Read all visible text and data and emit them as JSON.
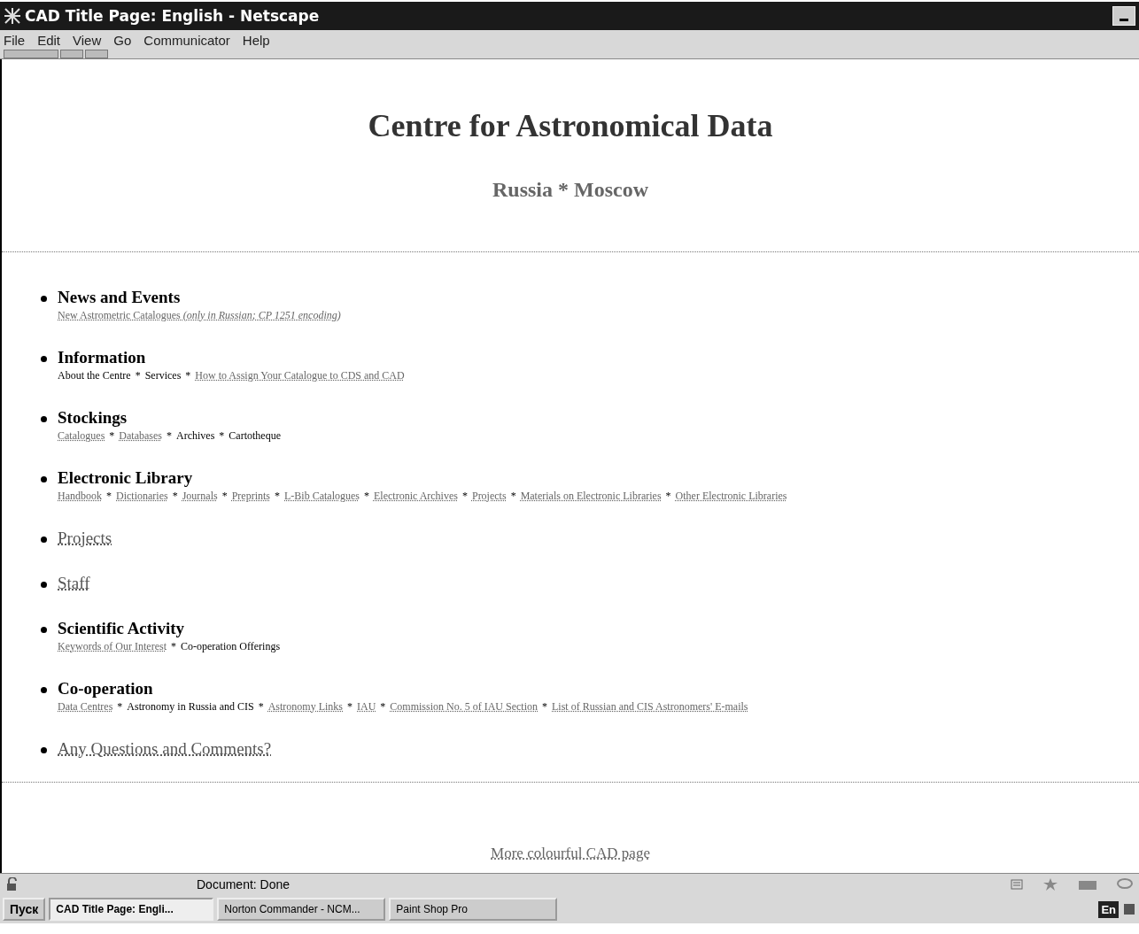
{
  "window": {
    "title": "CAD Title Page: English - Netscape"
  },
  "menu": [
    {
      "label": "File"
    },
    {
      "label": "Edit"
    },
    {
      "label": "View"
    },
    {
      "label": "Go"
    },
    {
      "label": "Communicator"
    },
    {
      "label": "Help"
    }
  ],
  "page": {
    "title": "Centre for Astronomical Data",
    "subtitle": "Russia * Moscow",
    "separator": "*",
    "sections": [
      {
        "title": "News and Events",
        "link": false,
        "items": [
          {
            "text": "New Astrometric Catalogues *(only in Russian; CP 1251 encoding)*",
            "link": true
          }
        ]
      },
      {
        "title": "Information",
        "link": false,
        "items": [
          {
            "text": "About the Centre",
            "link": false
          },
          {
            "text": "Services",
            "link": false
          },
          {
            "text": "How to Assign Your Catalogue to CDS and CAD",
            "link": true
          }
        ]
      },
      {
        "title": "Stockings",
        "link": false,
        "items": [
          {
            "text": "Catalogues",
            "link": true
          },
          {
            "text": "Databases",
            "link": true
          },
          {
            "text": "Archives",
            "link": false
          },
          {
            "text": "Cartotheque",
            "link": false
          }
        ]
      },
      {
        "title": "Electronic Library",
        "link": false,
        "items": [
          {
            "text": "Handbook",
            "link": true
          },
          {
            "text": "Dictionaries",
            "link": true
          },
          {
            "text": "Journals",
            "link": true
          },
          {
            "text": "Preprints",
            "link": true
          },
          {
            "text": "L-Bib Catalogues",
            "link": true
          },
          {
            "text": "Electronic Archives",
            "link": true
          },
          {
            "text": "Projects",
            "link": true
          },
          {
            "text": "Materials on Electronic Libraries",
            "link": true
          },
          {
            "text": "Other Electronic Libraries",
            "link": true
          }
        ]
      },
      {
        "title": "Projects",
        "link": true
      },
      {
        "title": "Staff",
        "link": true
      },
      {
        "title": "Scientific Activity",
        "link": false,
        "items": [
          {
            "text": "Keywords of Our Interest",
            "link": true
          },
          {
            "text": "Co-operation Offerings",
            "link": false
          }
        ]
      },
      {
        "title": "Co-operation",
        "link": false,
        "items": [
          {
            "text": "Data Centres",
            "link": true
          },
          {
            "text": "Astronomy in Russia and CIS",
            "link": false
          },
          {
            "text": "Astronomy Links",
            "link": true
          },
          {
            "text": "IAU",
            "link": true
          },
          {
            "text": "Commission No. 5 of IAU Section",
            "link": true
          },
          {
            "text": "List of Russian and CIS Astronomers' E-mails",
            "link": true
          }
        ]
      },
      {
        "title": "Any Questions and Comments?",
        "link": true
      }
    ],
    "footer_link": "More colourful CAD page"
  },
  "status_bar": {
    "text": "Document: Done"
  },
  "taskbar": {
    "start": "Пуск",
    "tasks": [
      {
        "label": "CAD Title Page: Engli...",
        "selected": true
      },
      {
        "label": "Norton Commander - NCM...",
        "selected": false
      },
      {
        "label": "Paint Shop Pro",
        "selected": false
      }
    ],
    "language": "En"
  }
}
